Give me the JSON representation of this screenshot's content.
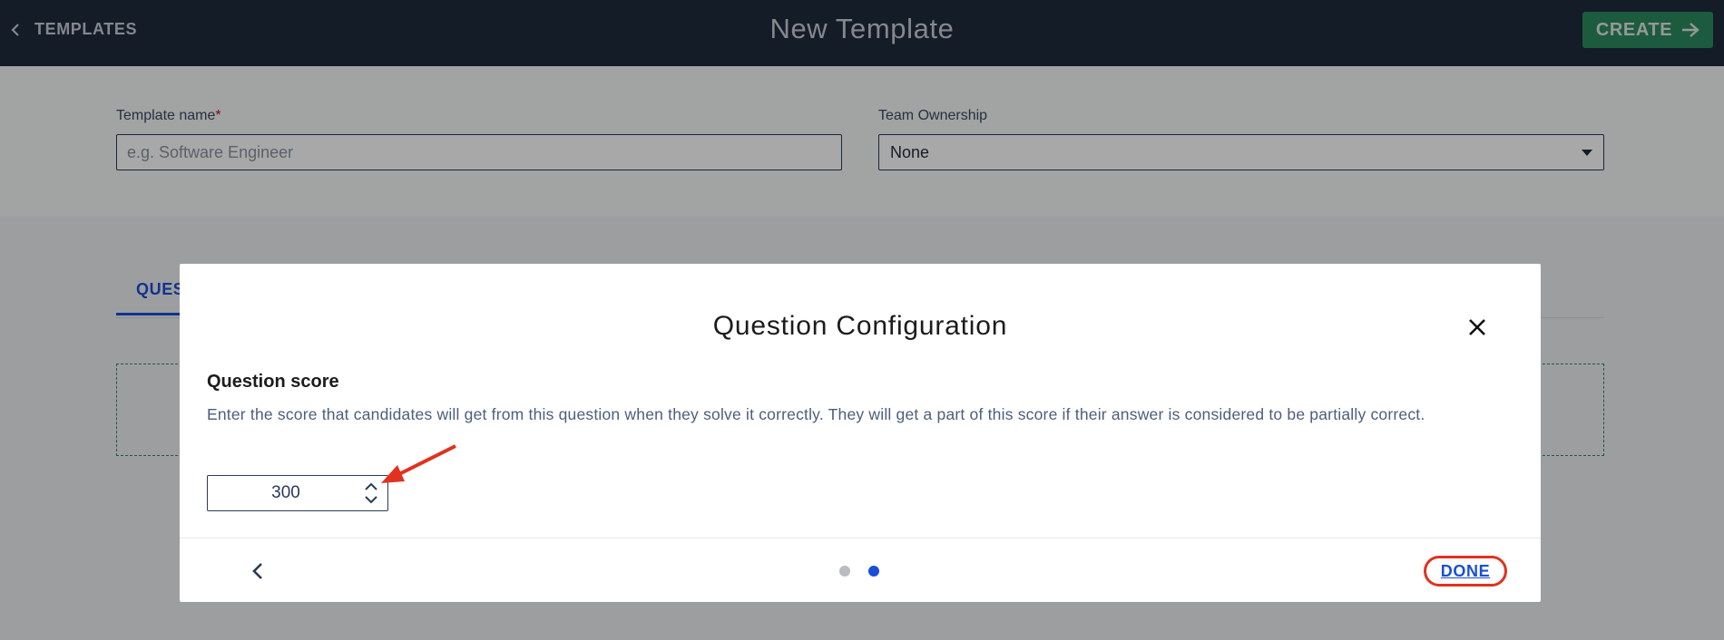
{
  "header": {
    "back_label": "TEMPLATES",
    "title": "New Template",
    "create_label": "CREATE"
  },
  "form": {
    "template_name_label": "Template name",
    "required_mark": "*",
    "template_name_placeholder": "e.g. Software Engineer",
    "template_name_value": "",
    "team_ownership_label": "Team Ownership",
    "team_ownership_selected": "None"
  },
  "tabs": {
    "active_label_partial": "QUES"
  },
  "modal": {
    "title": "Question Configuration",
    "score_label": "Question score",
    "score_help": "Enter the score that candidates will get from this question when they solve it correctly. They will get a part of this score if their answer is considered to be partially correct.",
    "score_value": "300",
    "pagination": {
      "current_page": 2,
      "total_pages": 2
    },
    "done_label": "DONE"
  },
  "icons": {
    "back": "chevron-left-icon",
    "create": "arrow-right-icon",
    "close": "close-icon",
    "stepper": "chevron-up-down-icon",
    "prev": "chevron-left-icon",
    "dropdown": "caret-down-icon"
  },
  "colors": {
    "header_bg": "#1f2b3d",
    "create_bg": "#2d8a5f",
    "accent_blue": "#1a4ed6",
    "annotation_red": "#e0321f"
  }
}
